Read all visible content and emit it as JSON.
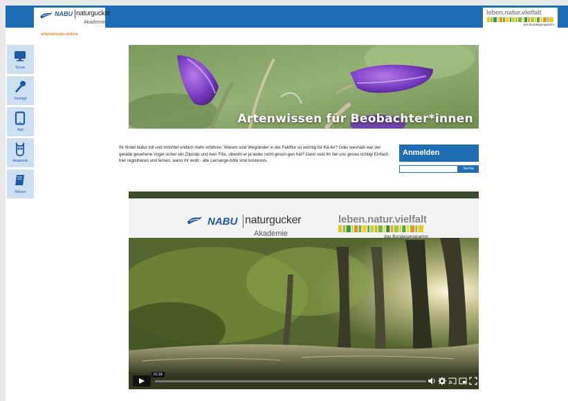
{
  "header": {
    "logo_nabu": "NABU",
    "logo_naturgucker": "naturgucker",
    "logo_akademie": "Akademie",
    "partner_title": "leben.natur.vielfalt",
    "partner_sub": "das Bundesprogramm"
  },
  "site_url": "artenwissen.online",
  "sidebar": {
    "items": [
      {
        "label": "Kurse",
        "icon": "monitor-icon"
      },
      {
        "label": "Vorträge",
        "icon": "microphone-icon"
      },
      {
        "label": "App",
        "icon": "tablet-icon"
      },
      {
        "label": "Akademie",
        "icon": "owl-icon"
      },
      {
        "label": "Wissen",
        "icon": "book-icon"
      }
    ]
  },
  "hero": {
    "title": "Artenwissen für Beobachter*innen"
  },
  "intro": {
    "text": "Ihr findet Natur toll und möchtet endlich mehr erfahren: Warum sind Wegränder in der Feldflur so wichtig für Kä-fer? Oder weshalb war der gerade gesehene Vogel sicher ein Zilpzalp und kein Fitis, obwohl er ja leider nicht gesun-gen hat? Dann seid Ihr bei uns genau richtig! Einfach hier registrieren und lernen, wann Ihr wollt - alle Lernange-bote sind kostenlos."
  },
  "login": {
    "label": "Anmelden",
    "search_value": "",
    "search_button": "Suche"
  },
  "video": {
    "banner_nabu": "NABU",
    "banner_naturgucker": "naturgucker",
    "banner_akademie": "Akademie",
    "banner_partner": "leben.natur.vielfalt",
    "banner_partner_sub": "das Bundesprogramm",
    "time": "01:18",
    "progress": 0.0
  },
  "colors": {
    "brand_blue": "#1e6db5",
    "sidebar_bg": "#cde0f2",
    "url_orange": "#e8862a"
  }
}
